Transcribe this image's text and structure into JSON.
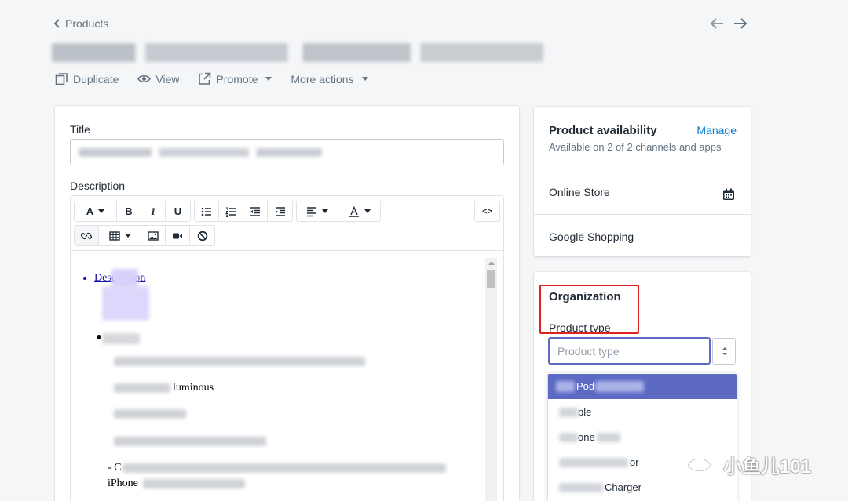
{
  "header": {
    "back_label": "Products",
    "prev_icon": "arrow-left-icon",
    "next_icon": "arrow-right-icon"
  },
  "actions": {
    "duplicate": "Duplicate",
    "view": "View",
    "promote": "Promote",
    "more": "More actions"
  },
  "product": {
    "title_label": "Title",
    "description_label": "Description"
  },
  "editor": {
    "font_button": "A",
    "bold": "B",
    "italic": "I",
    "underline": "U",
    "code_view": "<>",
    "content": {
      "item1_link": "Description",
      "item2_text_a": "luminous",
      "item2_text_b": "- C",
      "item2_text_c": "iPhone"
    }
  },
  "availability": {
    "title": "Product availability",
    "manage": "Manage",
    "subtitle": "Available on 2 of 2 channels and apps",
    "channels": [
      "Online Store",
      "Google Shopping"
    ]
  },
  "organization": {
    "title": "Organization",
    "product_type_label": "Product type",
    "product_type_placeholder": "Product type",
    "options": [
      "Pod",
      "ple",
      "one",
      "or",
      "Charger"
    ]
  },
  "watermark": {
    "text": "小鱼儿101"
  },
  "colors": {
    "accent": "#5c6ac4",
    "link": "#007ace",
    "highlight_box": "#e0221e"
  }
}
